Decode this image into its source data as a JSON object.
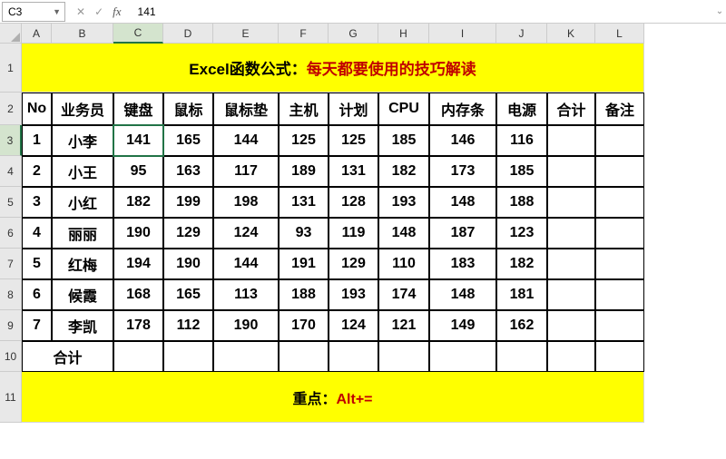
{
  "nameBox": "C3",
  "formulaValue": "141",
  "columns": [
    "A",
    "B",
    "C",
    "D",
    "E",
    "F",
    "G",
    "H",
    "I",
    "J",
    "K",
    "L"
  ],
  "rowCount": 11,
  "activeCol": "C",
  "activeRow": 3,
  "title": {
    "black": "Excel函数公式：",
    "red": "每天都要使用的技巧解读"
  },
  "headers": [
    "No",
    "业务员",
    "键盘",
    "鼠标",
    "鼠标垫",
    "主机",
    "计划",
    "CPU",
    "内存条",
    "电源",
    "合计",
    "备注"
  ],
  "rows": [
    {
      "no": "1",
      "name": "小李",
      "v": [
        "141",
        "165",
        "144",
        "125",
        "125",
        "185",
        "146",
        "116"
      ]
    },
    {
      "no": "2",
      "name": "小王",
      "v": [
        "95",
        "163",
        "117",
        "189",
        "131",
        "182",
        "173",
        "185"
      ]
    },
    {
      "no": "3",
      "name": "小红",
      "v": [
        "182",
        "199",
        "198",
        "131",
        "128",
        "193",
        "148",
        "188"
      ]
    },
    {
      "no": "4",
      "name": "丽丽",
      "v": [
        "190",
        "129",
        "124",
        "93",
        "119",
        "148",
        "187",
        "123"
      ]
    },
    {
      "no": "5",
      "name": "红梅",
      "v": [
        "194",
        "190",
        "144",
        "191",
        "129",
        "110",
        "183",
        "182"
      ]
    },
    {
      "no": "6",
      "name": "候霞",
      "v": [
        "168",
        "165",
        "113",
        "188",
        "193",
        "174",
        "148",
        "181"
      ]
    },
    {
      "no": "7",
      "name": "李凯",
      "v": [
        "178",
        "112",
        "190",
        "170",
        "124",
        "121",
        "149",
        "162"
      ]
    }
  ],
  "totalLabel": "合计",
  "footer": {
    "black": "重点：",
    "red": "Alt+="
  },
  "rowHeights": {
    "title": 54,
    "hdr": 36,
    "data": 34,
    "footer": 56
  },
  "chart_data": {
    "type": "table",
    "title": "Excel函数公式：每天都要使用的技巧解读",
    "columns": [
      "No",
      "业务员",
      "键盘",
      "鼠标",
      "鼠标垫",
      "主机",
      "计划",
      "CPU",
      "内存条",
      "电源",
      "合计",
      "备注"
    ],
    "data": [
      [
        1,
        "小李",
        141,
        165,
        144,
        125,
        125,
        185,
        146,
        116,
        null,
        null
      ],
      [
        2,
        "小王",
        95,
        163,
        117,
        189,
        131,
        182,
        173,
        185,
        null,
        null
      ],
      [
        3,
        "小红",
        182,
        199,
        198,
        131,
        128,
        193,
        148,
        188,
        null,
        null
      ],
      [
        4,
        "丽丽",
        190,
        129,
        124,
        93,
        119,
        148,
        187,
        123,
        null,
        null
      ],
      [
        5,
        "红梅",
        194,
        190,
        144,
        191,
        129,
        110,
        183,
        182,
        null,
        null
      ],
      [
        6,
        "候霞",
        168,
        165,
        113,
        188,
        193,
        174,
        148,
        181,
        null,
        null
      ],
      [
        7,
        "李凯",
        178,
        112,
        190,
        170,
        124,
        121,
        149,
        162,
        null,
        null
      ]
    ],
    "footer_note": "重点：Alt+="
  }
}
